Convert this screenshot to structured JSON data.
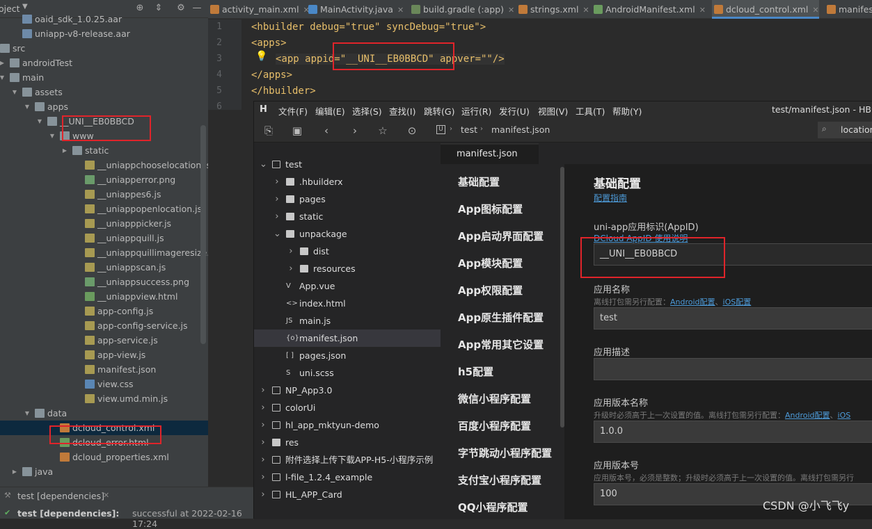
{
  "android_studio": {
    "project_label": "oject",
    "tabs": [
      {
        "label": "activity_main.xml",
        "color": "#c07a3a"
      },
      {
        "label": "MainActivity.java",
        "color": "#4a88c7"
      },
      {
        "label": "build.gradle (:app)",
        "color": "#6a8759"
      },
      {
        "label": "strings.xml",
        "color": "#c07a3a"
      },
      {
        "label": "AndroidManifest.xml",
        "color": "#6a9b5e"
      },
      {
        "label": "dcloud_control.xml",
        "color": "#c07a3a"
      },
      {
        "label": "manifes",
        "color": "#c07a3a"
      }
    ],
    "tree": [
      {
        "label": "oaid_sdk_1.0.25.aar",
        "kind": "aar"
      },
      {
        "label": "uniapp-v8-release.aar",
        "kind": "aar"
      },
      {
        "label": "src",
        "kind": "folder"
      },
      {
        "label": "androidTest",
        "kind": "folder"
      },
      {
        "label": "main",
        "kind": "folder"
      },
      {
        "label": "assets",
        "kind": "folder"
      },
      {
        "label": "apps",
        "kind": "folder"
      },
      {
        "label": "__UNI__EB0BBCD",
        "kind": "folder"
      },
      {
        "label": "www",
        "kind": "folder"
      },
      {
        "label": "static",
        "kind": "folder"
      },
      {
        "label": "__uniappchooselocation.js",
        "kind": "js"
      },
      {
        "label": "__uniapperror.png",
        "kind": "png"
      },
      {
        "label": "__uniappes6.js",
        "kind": "js"
      },
      {
        "label": "__uniappopenlocation.js",
        "kind": "js"
      },
      {
        "label": "__uniapppicker.js",
        "kind": "js"
      },
      {
        "label": "__uniappquill.js",
        "kind": "js"
      },
      {
        "label": "__uniappquillimageresize.js",
        "kind": "js"
      },
      {
        "label": "__uniappscan.js",
        "kind": "js"
      },
      {
        "label": "__uniappsuccess.png",
        "kind": "png"
      },
      {
        "label": "__uniappview.html",
        "kind": "html"
      },
      {
        "label": "app-config.js",
        "kind": "js"
      },
      {
        "label": "app-config-service.js",
        "kind": "js"
      },
      {
        "label": "app-service.js",
        "kind": "js"
      },
      {
        "label": "app-view.js",
        "kind": "js"
      },
      {
        "label": "manifest.json",
        "kind": "json"
      },
      {
        "label": "view.css",
        "kind": "css"
      },
      {
        "label": "view.umd.min.js",
        "kind": "js"
      },
      {
        "label": "data",
        "kind": "folder"
      },
      {
        "label": "dcloud_control.xml",
        "kind": "xml"
      },
      {
        "label": "dcloud_error.html",
        "kind": "html"
      },
      {
        "label": "dcloud_properties.xml",
        "kind": "xml"
      },
      {
        "label": "java",
        "kind": "folder"
      }
    ],
    "code_lines": [
      {
        "num": "1",
        "text": "<hbuilder debug=\"true\" syncDebug=\"true\">"
      },
      {
        "num": "2",
        "text": "<apps>"
      },
      {
        "num": "3",
        "text": "<app appid=\"__UNI__EB0BBCD\" appver=\"\"/>"
      },
      {
        "num": "4",
        "text": "</apps>"
      },
      {
        "num": "5",
        "text": "</hbuilder>"
      },
      {
        "num": "6",
        "text": ""
      }
    ],
    "build_tab": "test [dependencies]",
    "build_status_name": "test [dependencies]:",
    "build_status_rest": "successful at 2022-02-16 17:24"
  },
  "hbuilder": {
    "window_title": "test/manifest.json - HBuil",
    "menu": [
      "文件(F)",
      "编辑(E)",
      "选择(S)",
      "查找(I)",
      "跳转(G)",
      "运行(R)",
      "发行(U)",
      "视图(V)",
      "工具(T)",
      "帮助(Y)"
    ],
    "breadcrumb": [
      "test",
      "manifest.json"
    ],
    "search_text": "location",
    "file_tree": [
      {
        "label": "test",
        "kind": "project"
      },
      {
        "label": ".hbuilderx",
        "kind": "folder"
      },
      {
        "label": "pages",
        "kind": "folder"
      },
      {
        "label": "static",
        "kind": "folder"
      },
      {
        "label": "unpackage",
        "kind": "folder"
      },
      {
        "label": "dist",
        "kind": "folder"
      },
      {
        "label": "resources",
        "kind": "folder"
      },
      {
        "label": "App.vue",
        "kind": "file",
        "glyph": "V"
      },
      {
        "label": "index.html",
        "kind": "file",
        "glyph": "<>"
      },
      {
        "label": "main.js",
        "kind": "file",
        "glyph": "JS"
      },
      {
        "label": "manifest.json",
        "kind": "file",
        "glyph": "{o}"
      },
      {
        "label": "pages.json",
        "kind": "file",
        "glyph": "[ ]"
      },
      {
        "label": "uni.scss",
        "kind": "file",
        "glyph": "S"
      },
      {
        "label": "NP_App3.0",
        "kind": "project"
      },
      {
        "label": "colorUi",
        "kind": "project"
      },
      {
        "label": "hl_app_mktyun-demo",
        "kind": "project"
      },
      {
        "label": "res",
        "kind": "folder"
      },
      {
        "label": "附件选择上传下载APP-H5-小程序示例",
        "kind": "project"
      },
      {
        "label": "l-file_1.2.4_example",
        "kind": "project"
      },
      {
        "label": "HL_APP_Card",
        "kind": "project"
      }
    ],
    "editor_tab": "manifest.json",
    "config_nav": [
      "基础配置",
      "App图标配置",
      "App启动界面配置",
      "App模块配置",
      "App权限配置",
      "App原生插件配置",
      "App常用其它设置",
      "h5配置",
      "微信小程序配置",
      "百度小程序配置",
      "字节跳动小程序配置",
      "支付宝小程序配置",
      "QQ小程序配置"
    ],
    "form": {
      "heading": "基础配置",
      "guide_link": "配置指南",
      "appid_label": "uni-app应用标识(AppID)",
      "appid_link": "DCloud AppID 使用说明",
      "appid_value": "__UNI__EB0BBCD",
      "name_label": "应用名称",
      "name_hint": "离线打包需另行配置：",
      "name_hint_link1": "Android配置",
      "name_hint_sep": "、",
      "name_hint_link2": "iOS配置",
      "name_value": "test",
      "desc_label": "应用描述",
      "desc_value": "",
      "vername_label": "应用版本名称",
      "vername_hint": "升级时必须高于上一次设置的值。离线打包需另行配置：",
      "vername_hint_link1": "Android配置",
      "vername_hint_sep": "、",
      "vername_hint_link2": "iOS",
      "vername_value": "1.0.0",
      "vercode_label": "应用版本号",
      "vercode_hint": "应用版本号，必须是整数；升级时必须高于上一次设置的值。离线打包需另行",
      "vercode_value": "100"
    }
  },
  "watermark": "CSDN @小飞飞y"
}
